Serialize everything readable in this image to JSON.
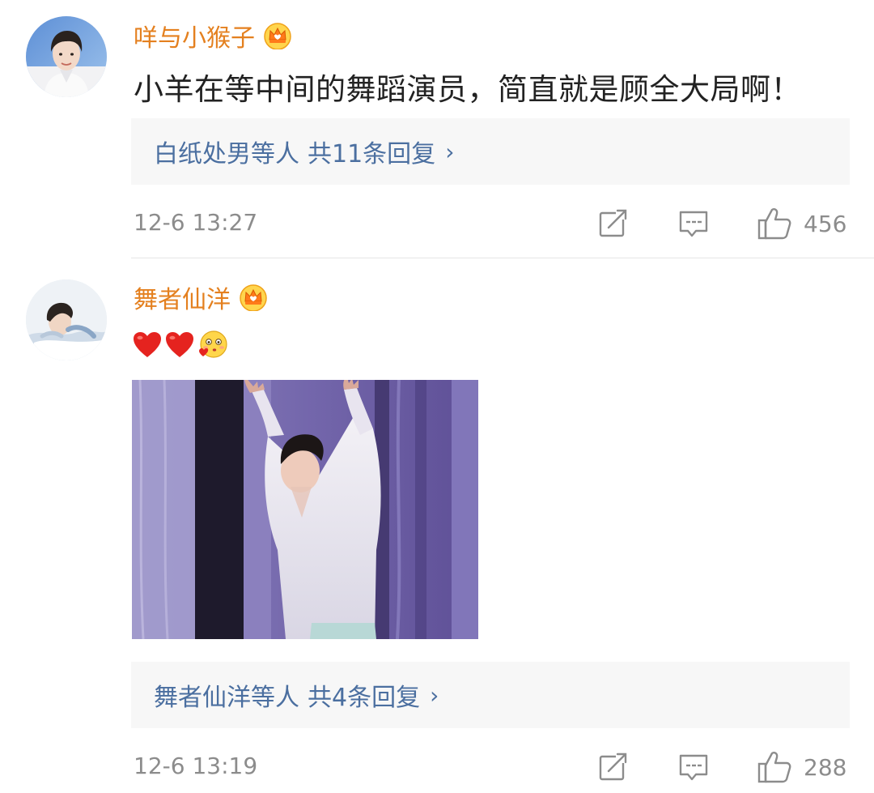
{
  "comments": [
    {
      "username": "咩与小猴子",
      "text": "小羊在等中间的舞蹈演员，简直就是顾全大局啊！",
      "reply_summary": {
        "names": "白纸处男等人",
        "count_label": "共11条回复",
        "chevron": "›"
      },
      "time": "12-6 13:27",
      "likes": "456"
    },
    {
      "username": "舞者仙洋",
      "emojis": [
        "heart-emoji",
        "heart-emoji",
        "kiss-face-emoji"
      ],
      "reply_summary": {
        "names": "舞者仙洋等人",
        "count_label": "共4条回复",
        "chevron": "›"
      },
      "time": "12-6 13:19",
      "likes": "288"
    }
  ],
  "icons": {
    "badge": "crown-badge-icon",
    "share": "share-icon",
    "reply": "comment-icon",
    "like": "thumbs-up-icon"
  },
  "colors": {
    "username": "#e4801f",
    "reply_link": "#4b6fa0",
    "meta": "#8c8c8c",
    "reply_box_bg": "#f7f7f7"
  }
}
